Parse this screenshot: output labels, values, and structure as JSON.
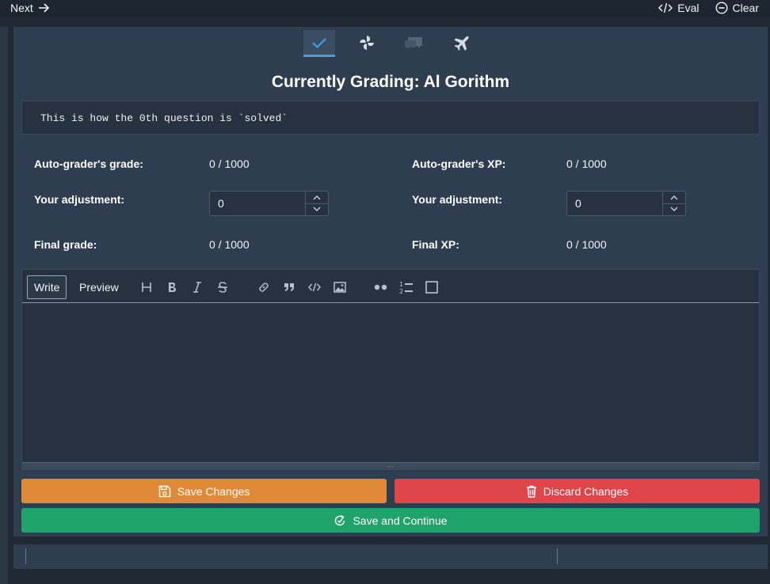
{
  "topbar": {
    "next_label": "Next",
    "eval_label": "Eval",
    "clear_label": "Clear"
  },
  "tabs": [
    {
      "icon": "check-icon",
      "active": true
    },
    {
      "icon": "pinwheel-icon",
      "active": false
    },
    {
      "icon": "comments-icon",
      "active": false
    },
    {
      "icon": "plane-icon",
      "active": false
    }
  ],
  "grading": {
    "title": "Currently Grading: Al Gorithm",
    "question_text": "This is how the 0th question is `solved`"
  },
  "grade": {
    "auto_label": "Auto-grader's grade:",
    "auto_value": "0 / 1000",
    "adjust_label": "Your adjustment:",
    "adjust_value": "0",
    "final_label": "Final grade:",
    "final_value": "0 / 1000"
  },
  "xp": {
    "auto_label": "Auto-grader's XP:",
    "auto_value": "0 / 1000",
    "adjust_label": "Your adjustment:",
    "adjust_value": "0",
    "final_label": "Final XP:",
    "final_value": "0 / 1000"
  },
  "editor": {
    "write_label": "Write",
    "preview_label": "Preview",
    "tools": [
      "heading-icon",
      "bold-icon",
      "italic-icon",
      "strikethrough-icon",
      "link-icon",
      "quote-icon",
      "code-icon",
      "image-icon",
      "bullet-list-icon",
      "numbered-list-icon",
      "checkbox-icon"
    ],
    "resize_glyph": "···"
  },
  "actions": {
    "save_label": "Save Changes",
    "discard_label": "Discard Changes",
    "continue_label": "Save and Continue"
  },
  "colors": {
    "save": "#e08a37",
    "discard": "#e0454a",
    "continue": "#1fa36a",
    "accent": "#3fa1e8"
  }
}
